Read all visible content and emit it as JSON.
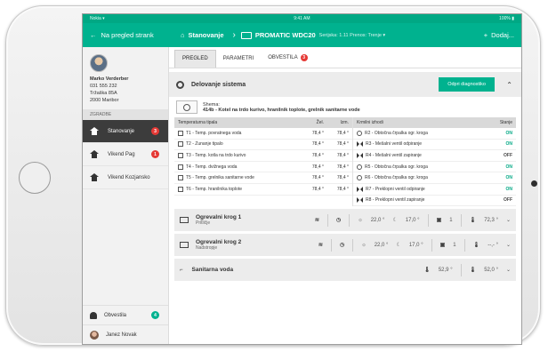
{
  "statusbar": {
    "left": "Nokia ▾",
    "center": "9:41 AM",
    "right": "100% ▮"
  },
  "topbar": {
    "back_label": "Na pregled strank",
    "location": "Stanovanje",
    "device_name": "PROMATIC WDC20",
    "device_meta": "Serijska: 1.11  Prenos: Trenje ▾",
    "add_label": "Dodaj..."
  },
  "user": {
    "name": "Marko Verderber",
    "phone": "031 555 232",
    "street": "Tržaška 85A",
    "city": "2000 Maribor"
  },
  "sidebar": {
    "section_title": "ZGRADBE",
    "items": [
      {
        "label": "Stanovanje",
        "badge": "3",
        "active": true
      },
      {
        "label": "Vikend Pag",
        "badge": "1",
        "active": false
      },
      {
        "label": "Vikend Kozjansko",
        "badge": "",
        "active": false
      }
    ],
    "bottom": [
      {
        "label": "Obvestila",
        "badge": "4"
      },
      {
        "label": "Janez Novak",
        "badge": ""
      }
    ]
  },
  "tabs": [
    {
      "label": "PREGLED",
      "active": true,
      "badge": ""
    },
    {
      "label": "PARAMETRI",
      "active": false,
      "badge": ""
    },
    {
      "label": "OBVESTILA",
      "active": false,
      "badge": "3"
    }
  ],
  "system": {
    "title": "Delovanje sistema",
    "diag_button": "Odpri diagnostiko",
    "scheme_label": "Shema:",
    "scheme_text": "414b - Kotel na trdo kurivo, hranilnik toplote, grelnik sanitarne vode"
  },
  "sensors": {
    "headers": {
      "name": "Temperaturna tipala",
      "req": "Žel.",
      "meas": "Izm."
    },
    "rows": [
      {
        "label": "T1 - Temp. povratnega voda",
        "req": "78,4 °",
        "meas": "78,4 °"
      },
      {
        "label": "T2 - Zunanje tipalo",
        "req": "78,4 °",
        "meas": "78,4 °"
      },
      {
        "label": "T3 - Temp. kotla na trdo kurivo",
        "req": "78,4 °",
        "meas": "78,4 °"
      },
      {
        "label": "T4 - Temp. dvižnega voda",
        "req": "78,4 °",
        "meas": "78,4 °"
      },
      {
        "label": "T5 - Temp. grelnika sanitarne vode",
        "req": "78,4 °",
        "meas": "78,4 °"
      },
      {
        "label": "T6 - Temp. hranilnika toplote",
        "req": "78,4 °",
        "meas": "78,4 °"
      }
    ]
  },
  "outputs": {
    "headers": {
      "name": "Krmilni izhodi",
      "state": "Stanje"
    },
    "rows": [
      {
        "label": "R2 - Obtočna črpalka ogr. kroga",
        "state": "ON",
        "icon": "pump"
      },
      {
        "label": "R3 - Mešalni ventil odpiranje",
        "state": "ON",
        "icon": "valve"
      },
      {
        "label": "R4 - Mešalni ventil zapiranje",
        "state": "OFF",
        "icon": "valve"
      },
      {
        "label": "R5 - Obtočna črpalka ogr. kroga",
        "state": "ON",
        "icon": "pump"
      },
      {
        "label": "R6 - Obtočna črpalka ogr. kroga",
        "state": "ON",
        "icon": "pump"
      },
      {
        "label": "R7 - Preklopni ventil odpiranje",
        "state": "ON",
        "icon": "valve"
      },
      {
        "label": "R8 - Preklopni ventil zapiranje",
        "state": "OFF",
        "icon": "valve"
      }
    ]
  },
  "circuits": [
    {
      "title": "Ogrevalni krog 1",
      "subtitle": "Pritličje",
      "day": "22,0 °",
      "night": "17,0 °",
      "mode": "1",
      "temp": "72,3 °"
    },
    {
      "title": "Ogrevalni krog 2",
      "subtitle": "Nadstropje",
      "day": "22,0 °",
      "night": "17,0 °",
      "mode": "1",
      "temp": "--,- °"
    }
  ],
  "dhw": {
    "title": "Sanitarna voda",
    "temp1": "52,9 °",
    "temp2": "52,0 °"
  },
  "colors": {
    "accent": "#00b28f",
    "alert": "#e53935"
  }
}
